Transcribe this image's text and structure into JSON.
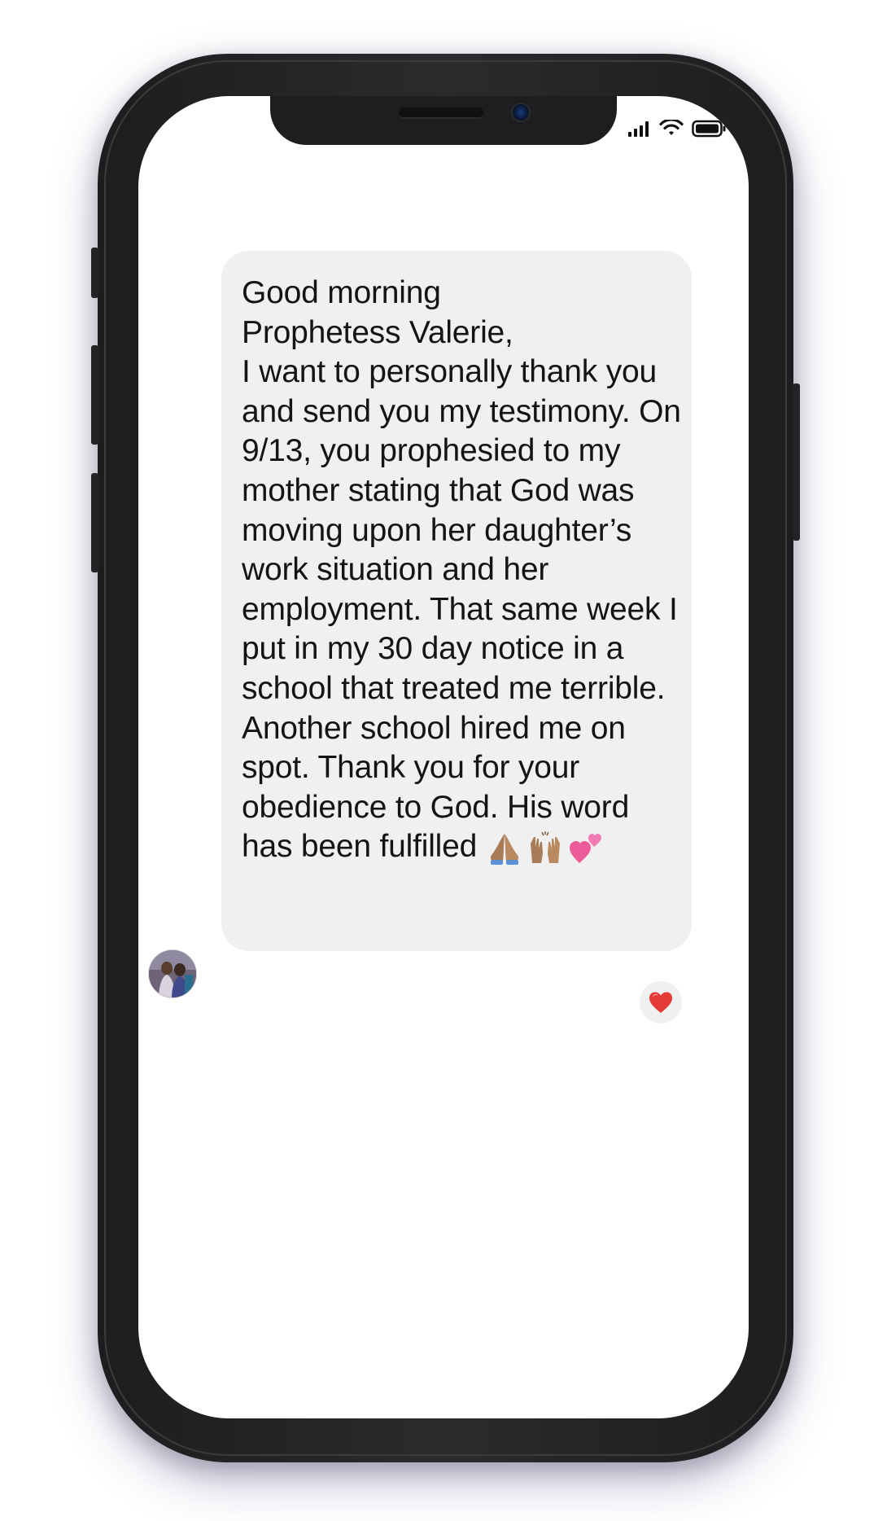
{
  "message": {
    "line1": "Good morning",
    "line2": "Prophetess Valerie,",
    "body": "I want to personally thank you and send you my testimony. On 9/13, you prophesied to my mother stating that God was moving upon her daughter’s work situation and her employment. That same week I put in my 30 day notice in a school that treated me terrible. Another school hired me on spot. Thank you for your obedience to God. His word has been fulfilled",
    "emojis": [
      "🙏🏽",
      "🙌🏽",
      "💕"
    ]
  },
  "reaction": "❤️",
  "icons": {
    "signal": "cellular-signal-icon",
    "wifi": "wifi-icon",
    "battery": "battery-icon",
    "avatar": "avatar-image",
    "reaction": "heart-icon"
  },
  "colors": {
    "bubble_bg": "#f0f0f0",
    "heart": "#e53935",
    "phone_frame": "#1d1d1f"
  }
}
